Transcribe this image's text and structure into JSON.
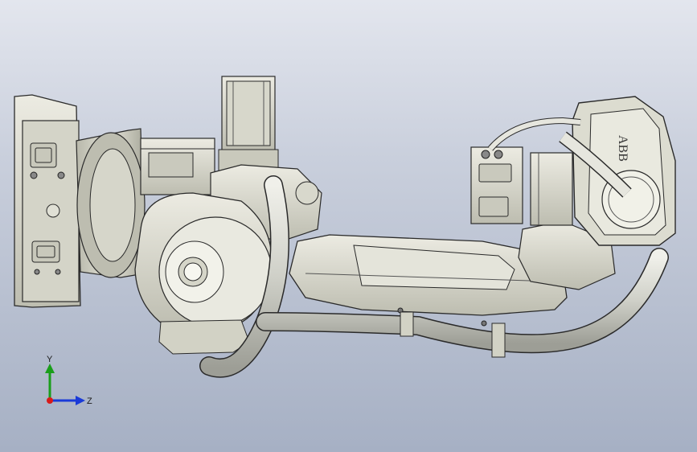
{
  "viewport": {
    "background_top": "#e3e6ee",
    "background_bottom": "#a6b0c4"
  },
  "model": {
    "brand_mark": "ABB",
    "part_color": "#d8d8cc",
    "edge_color": "#2a2a2a",
    "hose_color": "#cfd0c8"
  },
  "triad": {
    "y_label": "Y",
    "z_label": "Z",
    "y_color": "#1a9e1a",
    "z_color": "#1a3ad8",
    "x_color": "#d81a1a"
  }
}
